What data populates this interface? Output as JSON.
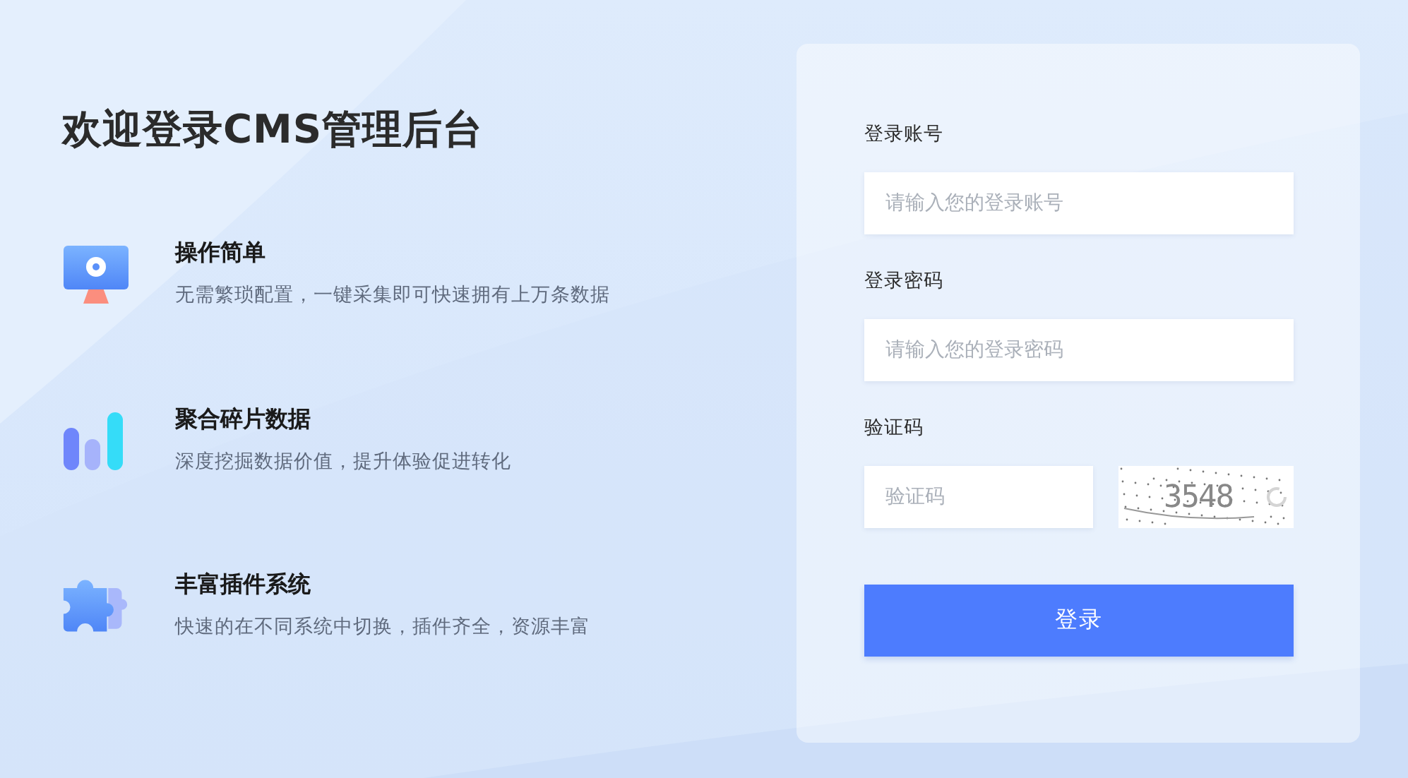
{
  "title": "欢迎登录CMS管理后台",
  "features": [
    {
      "kind": "monitor",
      "title": "操作简单",
      "description": "无需繁琐配置，一键采集即可快速拥有上万条数据"
    },
    {
      "kind": "chart",
      "title": "聚合碎片数据",
      "description": "深度挖掘数据价值，提升体验促进转化"
    },
    {
      "kind": "puzzle",
      "title": "丰富插件系统",
      "description": "快速的在不同系统中切换，插件齐全，资源丰富"
    }
  ],
  "form": {
    "account": {
      "label": "登录账号",
      "placeholder": "请输入您的登录账号"
    },
    "password": {
      "label": "登录密码",
      "placeholder": "请输入您的登录密码"
    },
    "captcha": {
      "label": "验证码",
      "placeholder": "验证码",
      "code": "3548"
    },
    "submit": "登录"
  }
}
